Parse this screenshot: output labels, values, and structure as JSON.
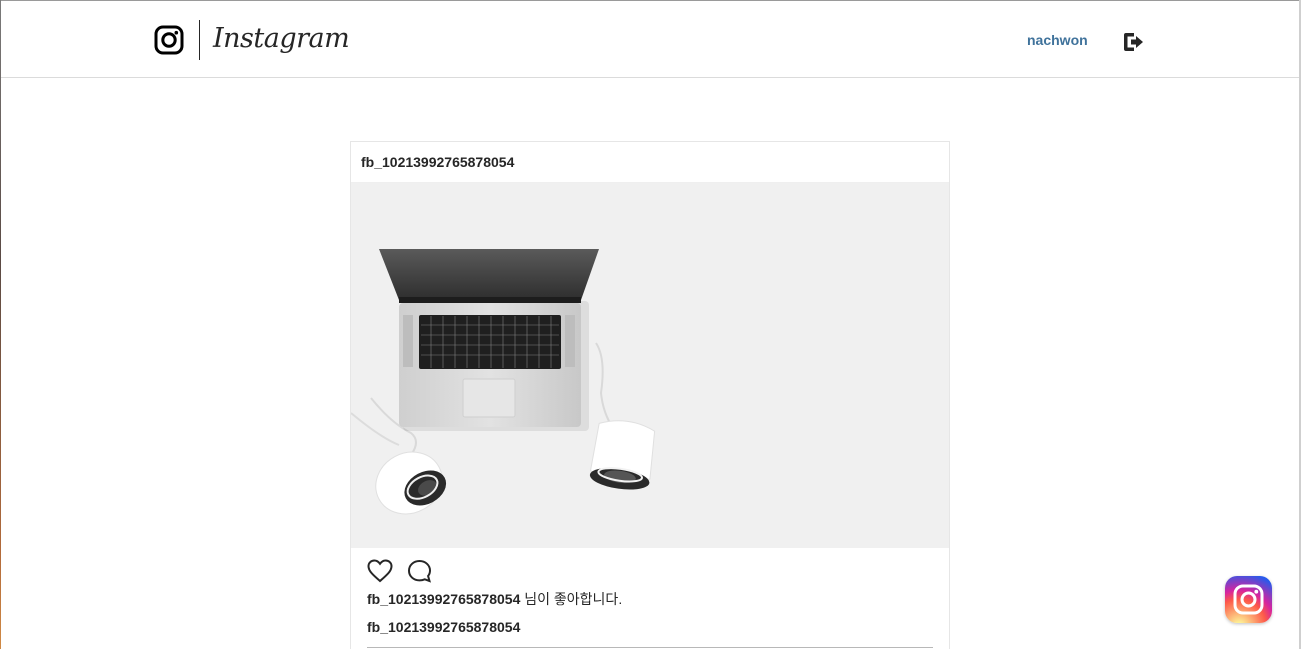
{
  "header": {
    "brand_wordmark": "Instagram",
    "username": "nachwon"
  },
  "post": {
    "author": "fb_10213992765878054",
    "likes": {
      "user": "fb_10213992765878054",
      "suffix": " 님이 좋아합니다."
    },
    "caption_author": "fb_10213992765878054"
  },
  "colors": {
    "link": "#3f729b",
    "border": "#dbdbdb",
    "image_bg": "#f0f0f0"
  },
  "icons": {
    "brand": "instagram-glyph-icon",
    "logout": "logout-icon",
    "like": "heart-outline-icon",
    "comment": "comment-bubble-icon",
    "floating": "instagram-app-icon"
  }
}
